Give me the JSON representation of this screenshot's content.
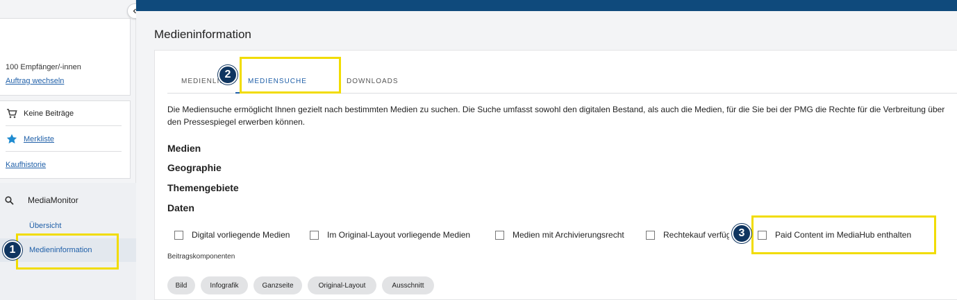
{
  "sidebar": {
    "recipients": "100 Empfänger/-innen",
    "change_order": "Auftrag wechseln",
    "no_items": "Keine Beiträge",
    "watchlist": "Merkliste",
    "purchase_history": "Kaufhistorie",
    "section_title": "MediaMonitor",
    "sub_overview": "Übersicht",
    "sub_active": "Medieninformation",
    "collapse_icon": "chevron-left-icon"
  },
  "main": {
    "title": "Medieninformation",
    "tabs": [
      {
        "label": "MEDIENLISTE"
      },
      {
        "label": "MEDIENSUCHE"
      },
      {
        "label": "DOWNLOADS"
      }
    ],
    "description": "Die Mediensuche ermöglicht Ihnen gezielt nach bestimmten Medien zu suchen. Die Suche umfasst sowohl den digitalen Bestand, als auch die Medien, für die Sie bei der PMG die Rechte für die Verbreitung über den Pressespiegel erwerben können.",
    "sections": [
      "Medien",
      "Geographie",
      "Themengebiete",
      "Daten"
    ],
    "checkboxes": [
      {
        "label": "Digital vorliegende Medien"
      },
      {
        "label": "Im Original-Layout vorliegende Medien"
      },
      {
        "label": "Medien mit Archivierungsrecht"
      },
      {
        "label": "Rechtekauf verfügbar"
      },
      {
        "label": "Paid Content im MediaHub enthalten"
      }
    ],
    "components_label": "Beitragskomponenten",
    "chips": [
      "Bild",
      "Infografik",
      "Ganzseite",
      "Original-Layout",
      "Ausschnitt"
    ]
  },
  "annotations": {
    "badges": [
      "1",
      "2",
      "3"
    ],
    "highlight_color": "#f1dc00",
    "badge_color": "#0f3560"
  },
  "colors": {
    "topbar": "#0f4a7c",
    "link": "#1f5fa8"
  }
}
